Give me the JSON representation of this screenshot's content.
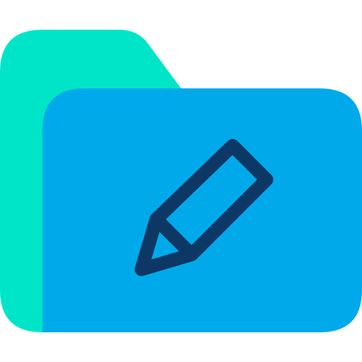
{
  "icon": {
    "name": "edit-folder-icon",
    "parts": {
      "folder_back": "folder-back-icon",
      "folder_front": "folder-front-icon",
      "pencil": "pencil-icon"
    },
    "colors": {
      "background": "#ffffff",
      "folder_back": "#00E5C8",
      "folder_front": "#00AAEA",
      "pencil_stroke": "#0D3865"
    }
  }
}
